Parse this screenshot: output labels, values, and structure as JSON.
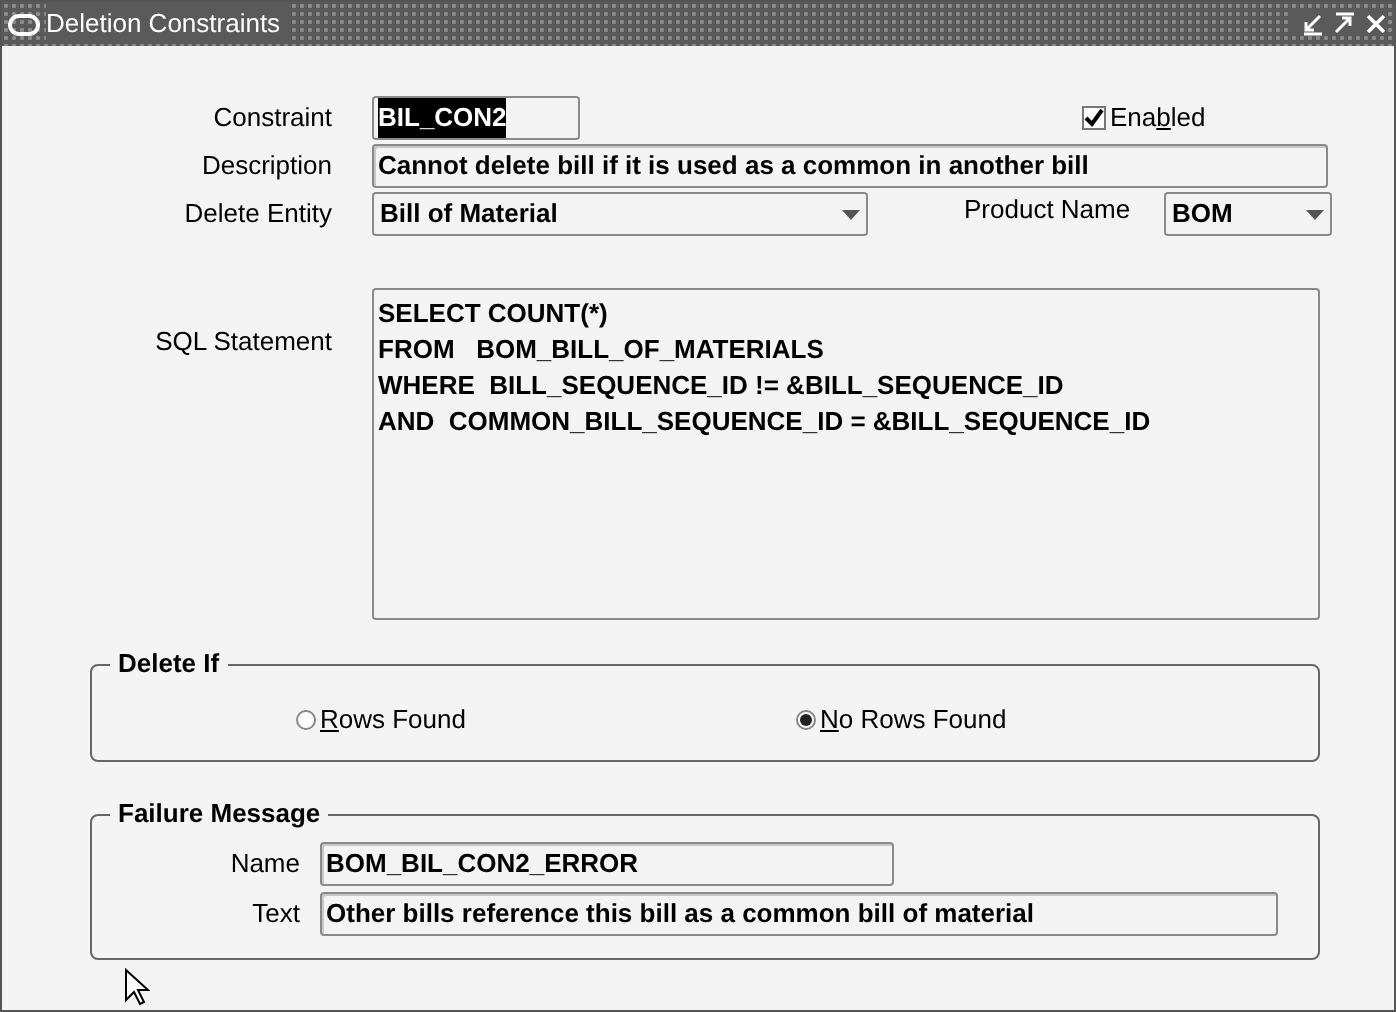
{
  "window": {
    "title": "Deletion Constraints"
  },
  "form": {
    "constraint": {
      "label": "Constraint",
      "value": "BIL_CON2",
      "selected_text": true
    },
    "enabled": {
      "label": {
        "before": "Ena",
        "access_key": "b",
        "after": "led"
      },
      "checked": true
    },
    "description": {
      "label": "Description",
      "value": "Cannot delete bill if it is used as a common in another bill"
    },
    "delete_entity": {
      "label": "Delete Entity",
      "value": "Bill of Material"
    },
    "product_name": {
      "label": "Product Name",
      "value": "BOM"
    },
    "sql_statement": {
      "label": "SQL Statement",
      "lines": [
        "SELECT COUNT(*)",
        "FROM   BOM_BILL_OF_MATERIALS",
        "WHERE  BILL_SEQUENCE_ID != &BILL_SEQUENCE_ID",
        "AND  COMMON_BILL_SEQUENCE_ID = &BILL_SEQUENCE_ID"
      ]
    }
  },
  "delete_if": {
    "title": "Delete If",
    "options": [
      {
        "label": {
          "access_key": "R",
          "after": "ows Found"
        },
        "selected": false
      },
      {
        "label": {
          "access_key": "N",
          "after": "o Rows Found"
        },
        "selected": true
      }
    ]
  },
  "failure_message": {
    "title": "Failure Message",
    "name": {
      "label": "Name",
      "value": "BOM_BIL_CON2_ERROR"
    },
    "text": {
      "label": "Text",
      "value": "Other bills reference this bill as a common bill of material"
    }
  }
}
